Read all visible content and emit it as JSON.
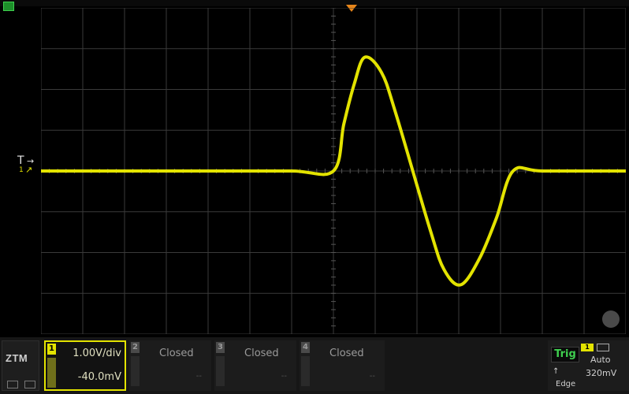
{
  "top": {
    "trigger_position_marker": "trigger-position-icon"
  },
  "markers": {
    "trigger_level": {
      "label": "T",
      "arrow": "→"
    },
    "ch1_ground": {
      "label": "1",
      "arrow": "↗"
    }
  },
  "bottom": {
    "logo": "ZTM",
    "ch1": {
      "number": "1",
      "scale": "1.00V/div",
      "offset": "-40.0mV"
    },
    "ch2": {
      "number": "2",
      "status": "Closed",
      "placeholder": "--"
    },
    "ch3": {
      "number": "3",
      "status": "Closed",
      "placeholder": "--"
    },
    "ch4": {
      "number": "4",
      "status": "Closed",
      "placeholder": "--"
    },
    "trigger": {
      "label": "Trig",
      "source": "1",
      "mode": "Auto",
      "slope": "↑",
      "level": "320mV",
      "type": "Edge"
    }
  },
  "colors": {
    "trace": "#e3e300",
    "grid": "#3a3a3a",
    "background": "#000000",
    "trigger_marker": "#e8861a",
    "trig_green": "#3fcf4f"
  },
  "chart_data": {
    "type": "line",
    "title": "",
    "xlabel": "",
    "ylabel": "",
    "x_divisions": 14,
    "y_divisions": 8,
    "grid": true,
    "series": [
      {
        "values": [
          [
            -7.0,
            0.0
          ],
          [
            -5.0,
            0.0
          ],
          [
            -3.0,
            0.0
          ],
          [
            -1.0,
            0.0
          ],
          [
            0.0,
            0.0
          ],
          [
            0.25,
            1.16
          ],
          [
            0.5,
            2.14
          ],
          [
            0.75,
            2.79
          ],
          [
            1.15,
            2.42
          ],
          [
            1.5,
            1.39
          ],
          [
            2.3,
            -1.39
          ],
          [
            2.65,
            -2.42
          ],
          [
            3.05,
            -2.79
          ],
          [
            3.5,
            -2.14
          ],
          [
            3.9,
            -1.16
          ],
          [
            4.3,
            0.0
          ],
          [
            5.0,
            0.0
          ],
          [
            7.0,
            0.0
          ]
        ]
      }
    ]
  }
}
